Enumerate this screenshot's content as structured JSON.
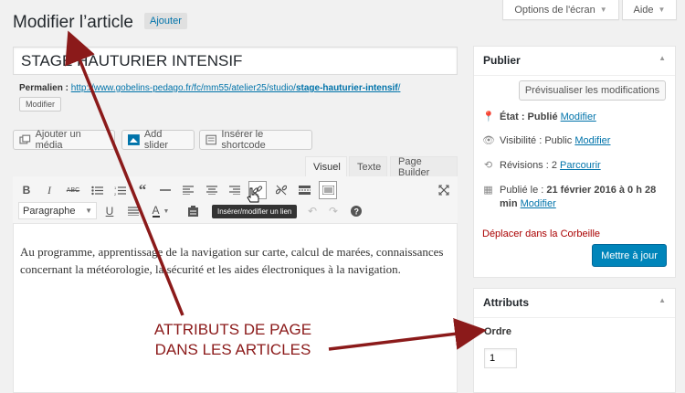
{
  "header": {
    "screen_options_label": "Options de l'écran",
    "help_label": "Aide",
    "page_title": "Modifier l’article",
    "add_label": "Ajouter"
  },
  "post": {
    "title": "STAGE HAUTURIER INTENSIF",
    "permalink_label": "Permalien :",
    "permalink_base": "http://www.gobelins-pedago.fr/fc/mm55/atelier25/studio/",
    "permalink_slug": "stage-hauturier-intensif",
    "permalink_end": "/",
    "modify_label": "Modifier"
  },
  "media_buttons": {
    "add_media": "Ajouter un média",
    "add_slider": "Add slider",
    "insert_shortcode": "Insérer le shortcode"
  },
  "editor_tabs": {
    "visual": "Visuel",
    "text": "Texte",
    "page_builder": "Page Builder"
  },
  "toolbar": {
    "format_select": "Paragraphe",
    "tooltip": "Insérer/modifier un lien"
  },
  "content": {
    "text": "Au programme, apprentissage de la navigation sur carte, calcul de marées, connaissances concernant la météorologie, la sécurité et les aides électroniques à la navigation."
  },
  "publish_box": {
    "title": "Publier",
    "preview_label": "Prévisualiser les modifications",
    "status_label": "État : Publié",
    "status_link": "Modifier",
    "visibility_label": "Visibilité : Public",
    "visibility_link": "Modifier",
    "revisions_label": "Révisions : 2",
    "revisions_link": "Parcourir",
    "published_prefix": "Publié le :",
    "published_date": "21 février 2016 à 0 h 28",
    "published_cont": "min",
    "published_link": "Modifier",
    "trash_label": "Déplacer dans la Corbeille",
    "update_label": "Mettre à jour"
  },
  "attributes_box": {
    "title": "Attributs",
    "order_label": "Ordre",
    "order_value": "1"
  },
  "annotation": {
    "line1": "ATTRIBUTS DE PAGE",
    "line2": "DANS LES ARTICLES"
  },
  "colors": {
    "accent": "#0073aa",
    "primary_button": "#0085ba",
    "annotation": "#8b1a1a",
    "trash": "#a00000"
  }
}
